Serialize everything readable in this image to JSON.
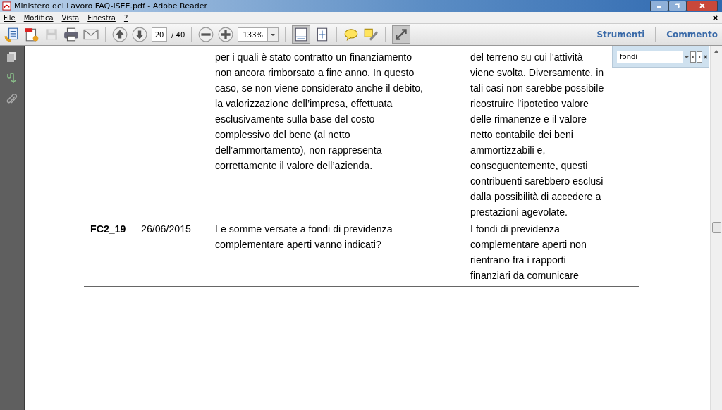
{
  "window": {
    "title": "Ministero del Lavoro FAQ-ISEE.pdf - Adobe Reader"
  },
  "menu": [
    "File",
    "Modifica",
    "Vista",
    "Finestra",
    "?"
  ],
  "toolbar": {
    "left": [
      {
        "kind": "create"
      },
      {
        "kind": "pdf"
      },
      {
        "kind": "save",
        "disabled": true
      },
      {
        "kind": "print"
      },
      {
        "kind": "mail"
      },
      {
        "kind": "sep"
      },
      {
        "kind": "up"
      },
      {
        "kind": "down"
      }
    ],
    "page": "20",
    "total": "/ 40",
    "zoom": "133%",
    "right_tabs": [
      "Strumenti",
      "Commento"
    ]
  },
  "find": {
    "value": "fondi"
  },
  "table": {
    "rows": [
      {
        "code": "",
        "date": "",
        "question": [
          "per i quali è stato contratto un finanziamento",
          "non ancora rimborsato a fine anno. In questo",
          "caso, se non viene considerato anche il debito,",
          "la valorizzazione dell’impresa, effettuata",
          "esclusivamente sulla base del costo",
          "complessivo del bene (al netto",
          "dell’ammortamento), non rappresenta",
          "correttamente il valore dell’azienda."
        ],
        "answer": [
          "del terreno su cui l'attività",
          "viene svolta. Diversamente, in",
          "tali casi non sarebbe possibile",
          "ricostruire l’ipotetico valore",
          "delle rimanenze e il valore",
          "netto contabile dei beni",
          "ammortizzabili e,",
          "conseguentemente, questi",
          "contribuenti sarebbero esclusi",
          "dalla possibilità di accedere a",
          "prestazioni agevolate."
        ]
      },
      {
        "code": "FC2_19",
        "date": "26/06/2015",
        "question": [
          "Le somme versate a fondi di previdenza",
          "complementare aperti vanno indicati?"
        ],
        "answer": [
          "I fondi di previdenza",
          "complementare aperti non",
          "rientrano fra i rapporti",
          "finanziari da comunicare"
        ]
      }
    ]
  }
}
